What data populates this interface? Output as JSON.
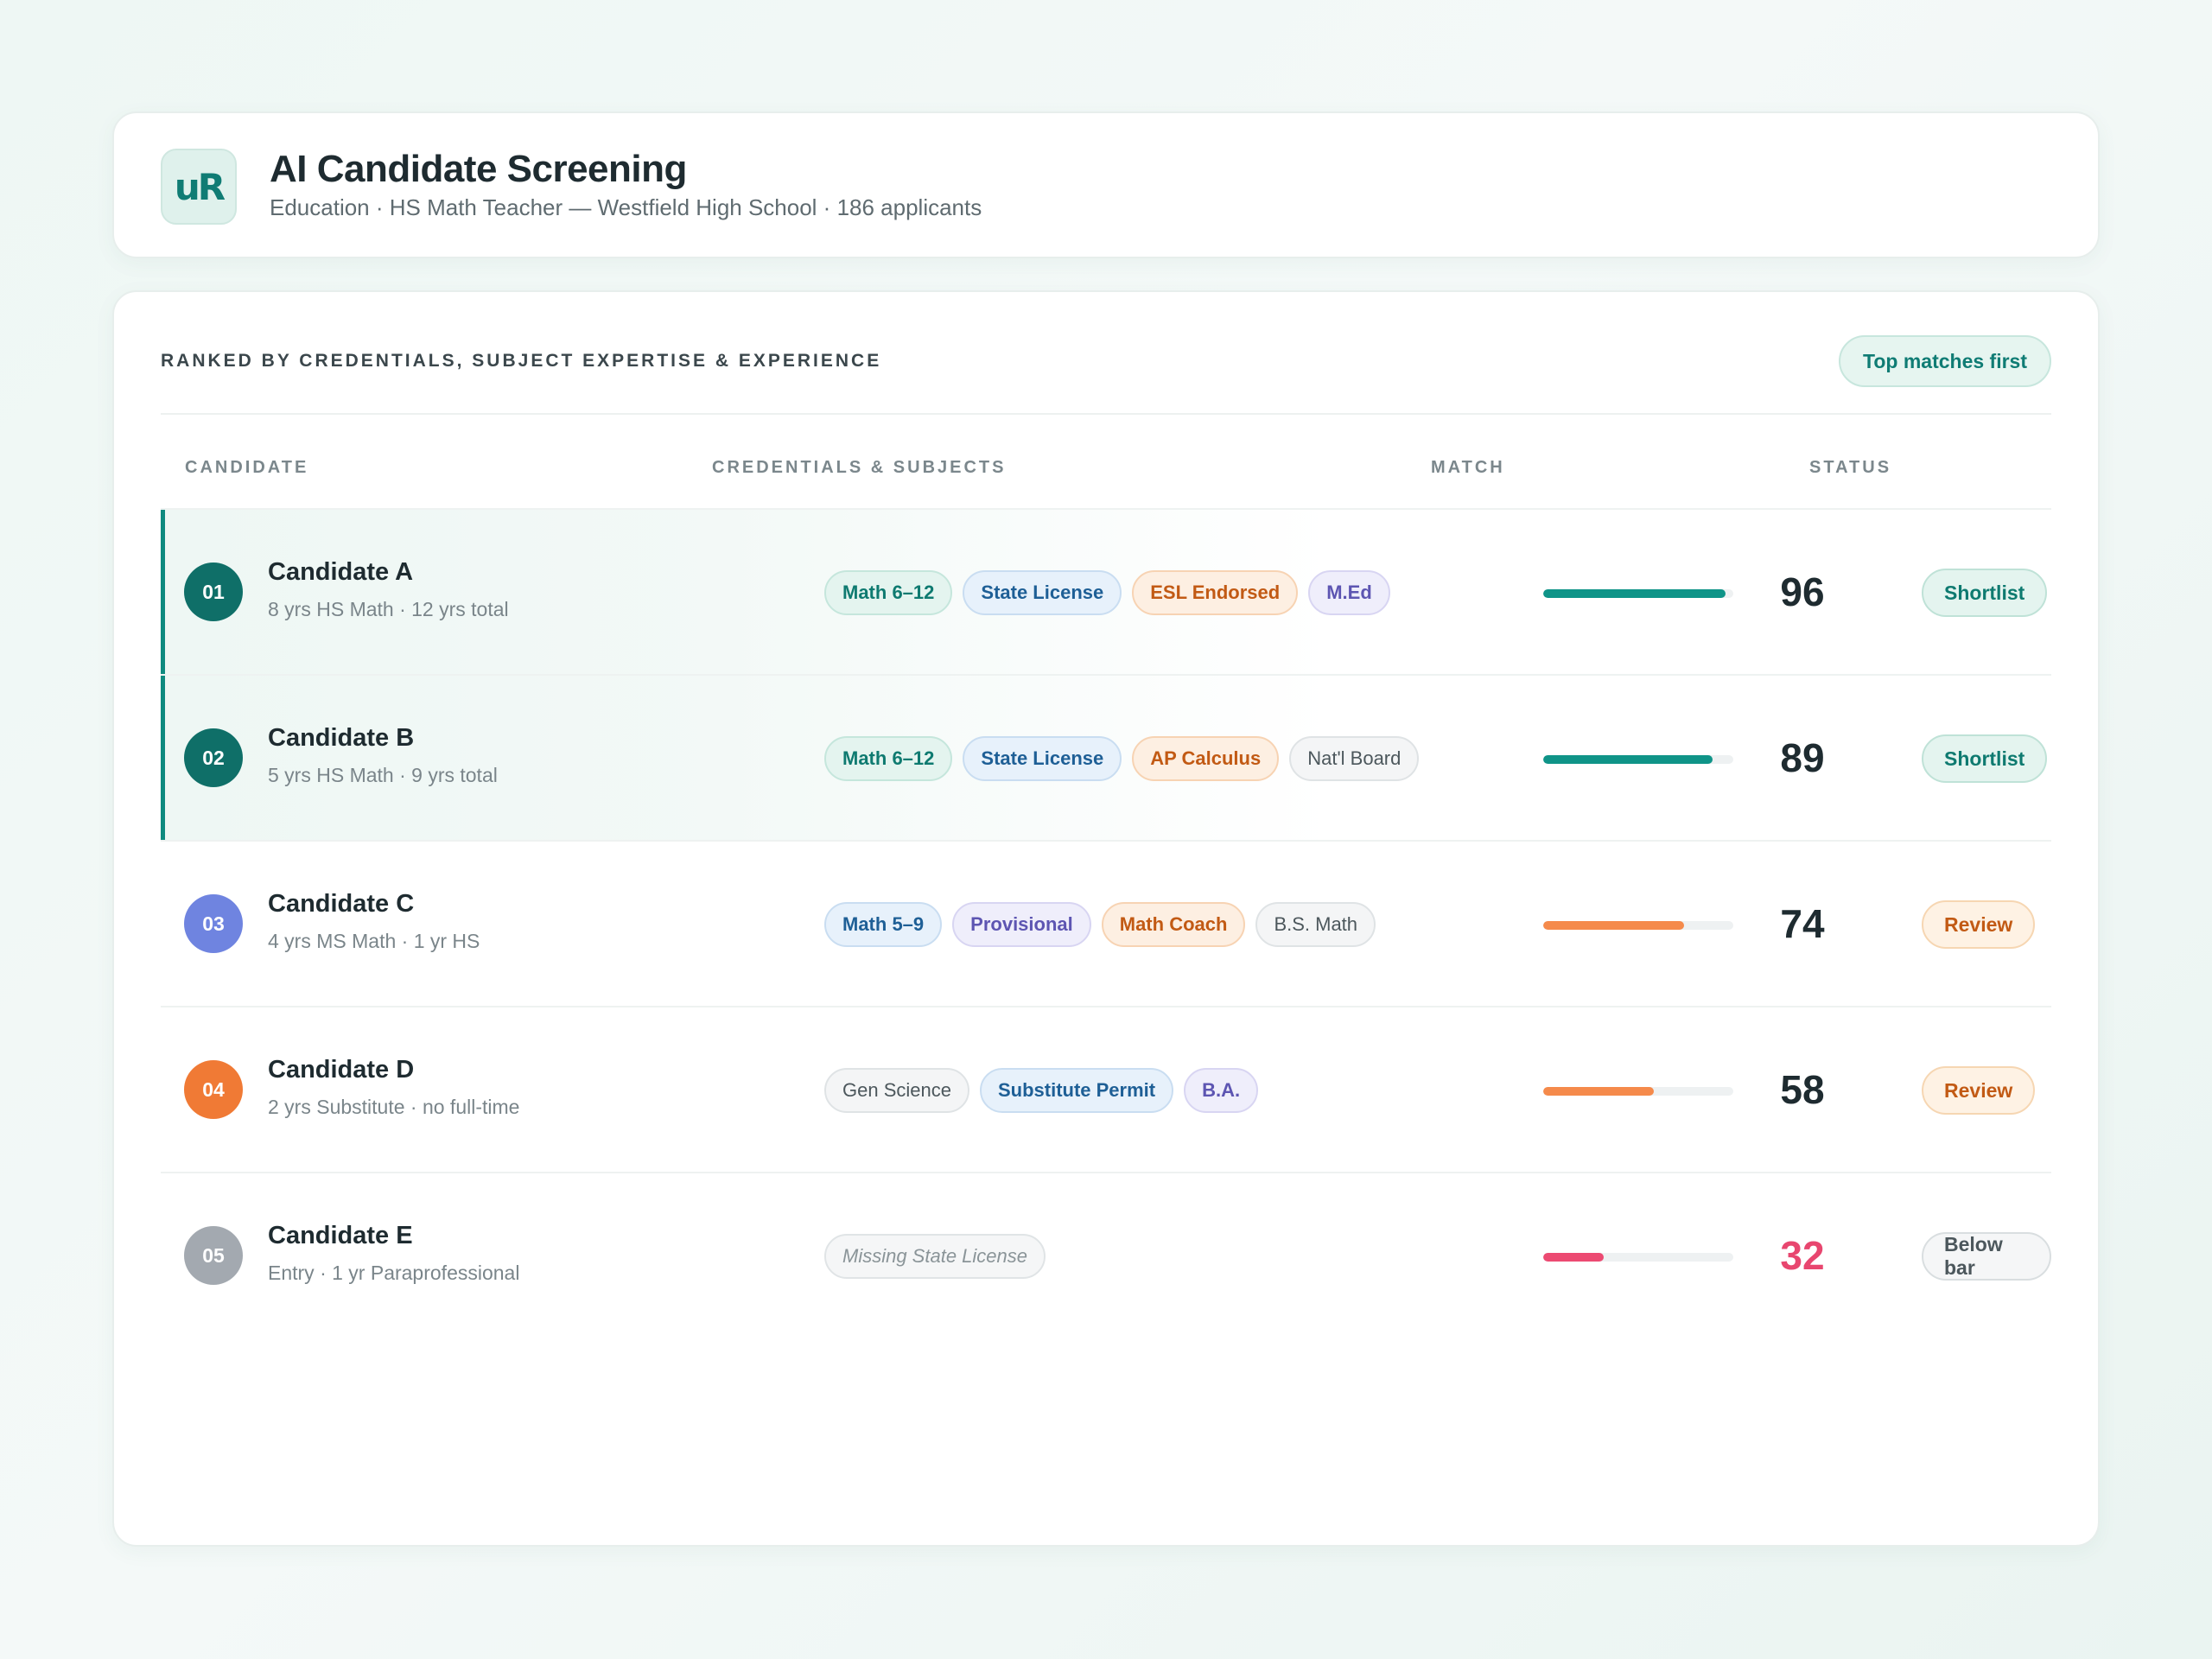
{
  "app": {
    "logo_text": "uR",
    "title": "AI Candidate Screening",
    "subtitle": "Education · HS Math Teacher — Westfield High School · 186 applicants"
  },
  "panel": {
    "section_title": "RANKED BY CREDENTIALS, SUBJECT EXPERTISE & EXPERIENCE",
    "sort_label": "Top matches first",
    "columns": [
      "CANDIDATE",
      "CREDENTIALS & SUBJECTS",
      "MATCH",
      "STATUS"
    ]
  },
  "colors": {
    "accent": "#0f7c74",
    "teal_bar": "#0f9488",
    "orange_bar": "#f58a4b",
    "red_bar": "#ec4a72",
    "low_score": "#e8466f"
  },
  "candidates": [
    {
      "rank": "01",
      "name": "Candidate A",
      "meta": "8 yrs HS Math · 12 yrs total",
      "rank_color": "#0f6f68",
      "tags": [
        {
          "label": "Math 6–12",
          "style": "teal"
        },
        {
          "label": "State License",
          "style": "blue"
        },
        {
          "label": "ESL Endorsed",
          "style": "orange"
        },
        {
          "label": "M.Ed",
          "style": "purple"
        }
      ],
      "match": 96,
      "match_bar_fraction": 0.96,
      "bar_color": "#0f9488",
      "status": "Shortlist",
      "status_style": "shortlist",
      "shortlisted": true
    },
    {
      "rank": "02",
      "name": "Candidate B",
      "meta": "5 yrs HS Math · 9 yrs total",
      "rank_color": "#0f6f68",
      "tags": [
        {
          "label": "Math 6–12",
          "style": "teal"
        },
        {
          "label": "State License",
          "style": "blue"
        },
        {
          "label": "AP Calculus",
          "style": "orange"
        },
        {
          "label": "Nat'l Board",
          "style": "gray"
        }
      ],
      "match": 89,
      "match_bar_fraction": 0.89,
      "bar_color": "#0f9488",
      "status": "Shortlist",
      "status_style": "shortlist",
      "shortlisted": true
    },
    {
      "rank": "03",
      "name": "Candidate C",
      "meta": "4 yrs MS Math · 1 yr HS",
      "rank_color": "#6f84e0",
      "tags": [
        {
          "label": "Math 5–9",
          "style": "blue"
        },
        {
          "label": "Provisional",
          "style": "purple"
        },
        {
          "label": "Math Coach",
          "style": "orange"
        },
        {
          "label": "B.S. Math",
          "style": "gray"
        }
      ],
      "match": 74,
      "match_bar_fraction": 0.74,
      "bar_color": "#f58a4b",
      "status": "Review",
      "status_style": "review",
      "shortlisted": false
    },
    {
      "rank": "04",
      "name": "Candidate D",
      "meta": "2 yrs Substitute · no full-time",
      "rank_color": "#f07a35",
      "tags": [
        {
          "label": "Gen Science",
          "style": "gray"
        },
        {
          "label": "Substitute Permit",
          "style": "blue"
        },
        {
          "label": "B.A.",
          "style": "purple"
        }
      ],
      "match": 58,
      "match_bar_fraction": 0.58,
      "bar_color": "#f58a4b",
      "status": "Review",
      "status_style": "review",
      "shortlisted": false
    },
    {
      "rank": "05",
      "name": "Candidate E",
      "meta": "Entry · 1 yr Paraprofessional",
      "rank_color": "#a3a9b0",
      "tags": [
        {
          "label": "Missing State License",
          "style": "missing"
        }
      ],
      "match": 32,
      "match_bar_fraction": 0.32,
      "bar_color": "#ec4a72",
      "score_color": "#e8466f",
      "status": "Below bar",
      "status_style": "below",
      "shortlisted": false
    }
  ]
}
